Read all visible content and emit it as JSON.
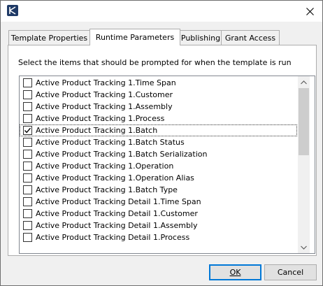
{
  "window": {
    "close_glyph": "✕"
  },
  "tabs": [
    {
      "label": "Template Properties",
      "active": false
    },
    {
      "label": "Runtime Parameters",
      "active": true
    },
    {
      "label": "Publishing",
      "active": false
    },
    {
      "label": "Grant Access",
      "active": false
    }
  ],
  "panel": {
    "instruction": "Select the items that should be prompted for when the template is run"
  },
  "items": [
    {
      "label": "Active Product Tracking 1.Time Span",
      "checked": false
    },
    {
      "label": "Active Product Tracking 1.Customer",
      "checked": false
    },
    {
      "label": "Active Product Tracking 1.Assembly",
      "checked": false
    },
    {
      "label": "Active Product Tracking 1.Process",
      "checked": false
    },
    {
      "label": "Active Product Tracking 1.Batch",
      "checked": true
    },
    {
      "label": "Active Product Tracking 1.Batch Status",
      "checked": false
    },
    {
      "label": "Active Product Tracking 1.Batch Serialization",
      "checked": false
    },
    {
      "label": "Active Product Tracking 1.Operation",
      "checked": false
    },
    {
      "label": "Active Product Tracking 1.Operation Alias",
      "checked": false
    },
    {
      "label": "Active Product Tracking 1.Batch Type",
      "checked": false
    },
    {
      "label": "Active Product Tracking Detail 1.Time Span",
      "checked": false
    },
    {
      "label": "Active Product Tracking Detail 1.Customer",
      "checked": false
    },
    {
      "label": "Active Product Tracking Detail 1.Assembly",
      "checked": false
    },
    {
      "label": "Active Product Tracking Detail 1.Process",
      "checked": false
    }
  ],
  "buttons": {
    "ok": "OK",
    "cancel": "Cancel"
  },
  "colors": {
    "accent": "#0078d7",
    "app_icon": "#1f3a66"
  },
  "icons": {
    "app": "app-logo-icon",
    "close": "close-icon",
    "check": "checkmark-icon",
    "scroll_up": "chevron-up-icon",
    "scroll_down": "chevron-down-icon"
  }
}
